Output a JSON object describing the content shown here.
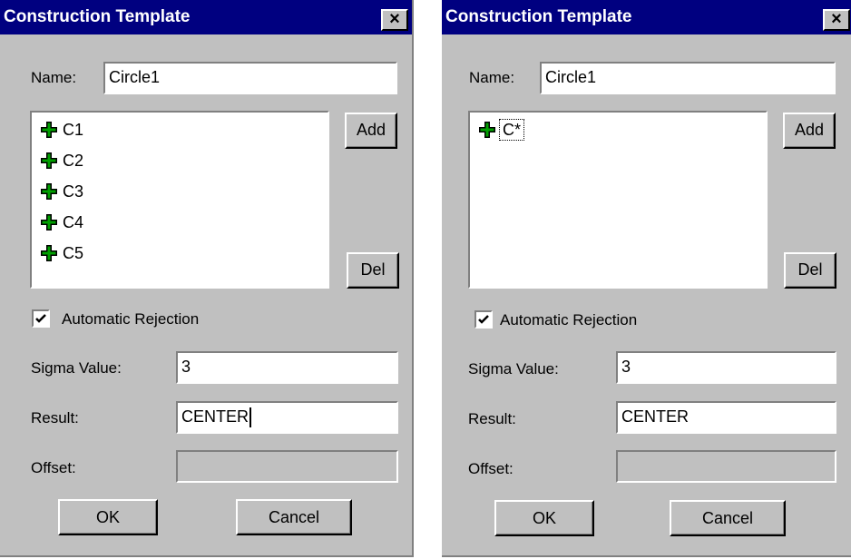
{
  "dialogs": [
    {
      "title": "Construction Template",
      "close_glyph": "×",
      "name_label": "Name:",
      "name_value": "Circle1",
      "list_items": [
        "C1",
        "C2",
        "C3",
        "C4",
        "C5"
      ],
      "add_label": "Add",
      "del_label": "Del",
      "auto_reject_label": "Automatic Rejection",
      "auto_reject_checked": true,
      "sigma_label": "Sigma Value:",
      "sigma_value": "3",
      "result_label": "Result:",
      "result_value": "CENTER",
      "offset_label": "Offset:",
      "offset_value": "",
      "ok_label": "OK",
      "cancel_label": "Cancel"
    },
    {
      "title": "Construction Template",
      "close_glyph": "×",
      "name_label": "Name:",
      "name_value": "Circle1",
      "list_items": [
        "C*"
      ],
      "add_label": "Add",
      "del_label": "Del",
      "auto_reject_label": "Automatic Rejection",
      "auto_reject_checked": true,
      "sigma_label": "Sigma Value:",
      "sigma_value": "3",
      "result_label": "Result:",
      "result_value": "CENTER",
      "offset_label": "Offset:",
      "offset_value": "",
      "ok_label": "OK",
      "cancel_label": "Cancel"
    }
  ],
  "colors": {
    "face": "#c0c0c0",
    "titlebar": "#000080",
    "plus_icon": "#00a000"
  },
  "icons": {
    "list_item": "green-plus-icon",
    "close": "close-icon",
    "check": "checkmark-icon"
  }
}
